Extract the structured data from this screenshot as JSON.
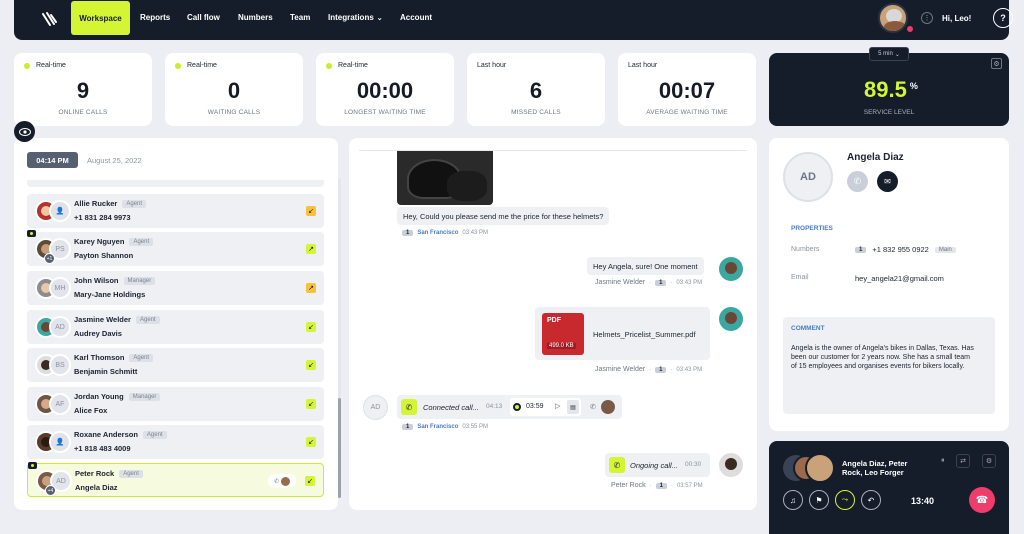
{
  "nav": {
    "items": [
      "Workspace",
      "Reports",
      "Call flow",
      "Numbers",
      "Team",
      "Integrations",
      "Account"
    ],
    "user_greeting": "Hi, Leo!"
  },
  "stats": [
    {
      "label": "Real-time",
      "live": true,
      "value": "9",
      "sub": "ONLINE CALLS"
    },
    {
      "label": "Real-time",
      "live": true,
      "value": "0",
      "sub": "WAITING CALLS"
    },
    {
      "label": "Real-time",
      "live": true,
      "value": "00:00",
      "sub": "LONGEST WAITING TIME"
    },
    {
      "label": "Last hour",
      "live": false,
      "value": "6",
      "sub": "MISSED CALLS"
    },
    {
      "label": "Last hour",
      "live": false,
      "value": "00:07",
      "sub": "AVERAGE WAITING TIME"
    }
  ],
  "service": {
    "interval": "5 min",
    "value": "89.5",
    "unit": "%",
    "label": "SERVICE LEVEL",
    "value_color": "#d3f534"
  },
  "list": {
    "time": "04:14 PM",
    "date": "August 25, 2022",
    "contacts": [
      {
        "name": "Allie Rucker",
        "role": "Agent",
        "sub": "+1 831 284 9973",
        "arrow": "↙",
        "arrow_color": "o",
        "initials": "",
        "badge": false
      },
      {
        "name": "Karey Nguyen",
        "role": "Agent",
        "sub": "Payton Shannon",
        "arrow": "↗",
        "arrow_color": "g",
        "initials": "PS",
        "badge": true,
        "count": "+1"
      },
      {
        "name": "John Wilson",
        "role": "Manager",
        "sub": "Mary-Jane Holdings",
        "arrow": "↗",
        "arrow_color": "o",
        "initials": "MH",
        "badge": false
      },
      {
        "name": "Jasmine Welder",
        "role": "Agent",
        "sub": "Audrey Davis",
        "arrow": "↙",
        "arrow_color": "g",
        "initials": "AD",
        "badge": false
      },
      {
        "name": "Karl Thomson",
        "role": "Agent",
        "sub": "Benjamin Schmitt",
        "arrow": "↙",
        "arrow_color": "g",
        "initials": "BS",
        "badge": false
      },
      {
        "name": "Jordan Young",
        "role": "Manager",
        "sub": "Alice Fox",
        "arrow": "↙",
        "arrow_color": "g",
        "initials": "AF",
        "badge": false
      },
      {
        "name": "Roxane Anderson",
        "role": "Agent",
        "sub": "+1 818 483 4009",
        "arrow": "↙",
        "arrow_color": "g",
        "initials": "",
        "badge": false
      },
      {
        "name": "Peter Rock",
        "role": "Agent",
        "sub": "Angela Diaz",
        "arrow": "↙",
        "arrow_color": "g",
        "initials": "AD",
        "badge": true,
        "count": "+4",
        "selected": true
      }
    ]
  },
  "chat": {
    "m1": {
      "text": "Hey, Could you please send me the price for these helmets?",
      "num": "1",
      "place": "San Francisco",
      "time": "03:43 PM"
    },
    "m2": {
      "text": "Hey Angela, sure! One moment",
      "who": "Jasmine Welder",
      "num": "1",
      "time": "03:43 PM"
    },
    "m3": {
      "file": "Helmets_Pricelist_Summer.pdf",
      "size": "499.0 KB",
      "ext": "PDF",
      "who": "Jasmine Welder",
      "num": "1",
      "time": "03:43 PM"
    },
    "m4": {
      "text": "Connected call...",
      "dur": "04:13",
      "rec": "03:59",
      "num": "1",
      "place": "San Francisco",
      "time": "03:55 PM",
      "avatar": "AD"
    },
    "m5": {
      "text": "Ongoing call...",
      "dur": "00:30",
      "who": "Peter Rock",
      "num": "1",
      "time": "03:57 PM"
    }
  },
  "profile": {
    "initials": "AD",
    "name": "Angela Diaz",
    "properties_title": "PROPERTIES",
    "numbers_label": "Numbers",
    "num_badge": "1",
    "phone": "+1 832 955 0922",
    "main": "Main",
    "email_label": "Email",
    "email": "hey_angela21@gmail.com",
    "comment_title": "COMMENT",
    "comment": "Angela is the owner of Angela's bikes in Dallas, Texas. Has been our customer for 2 years now. She has a small team of 15 employees and organises events for bikers locally."
  },
  "call": {
    "names": "Angela Diaz, Peter Rock, Leo Forger",
    "time": "13:40"
  }
}
